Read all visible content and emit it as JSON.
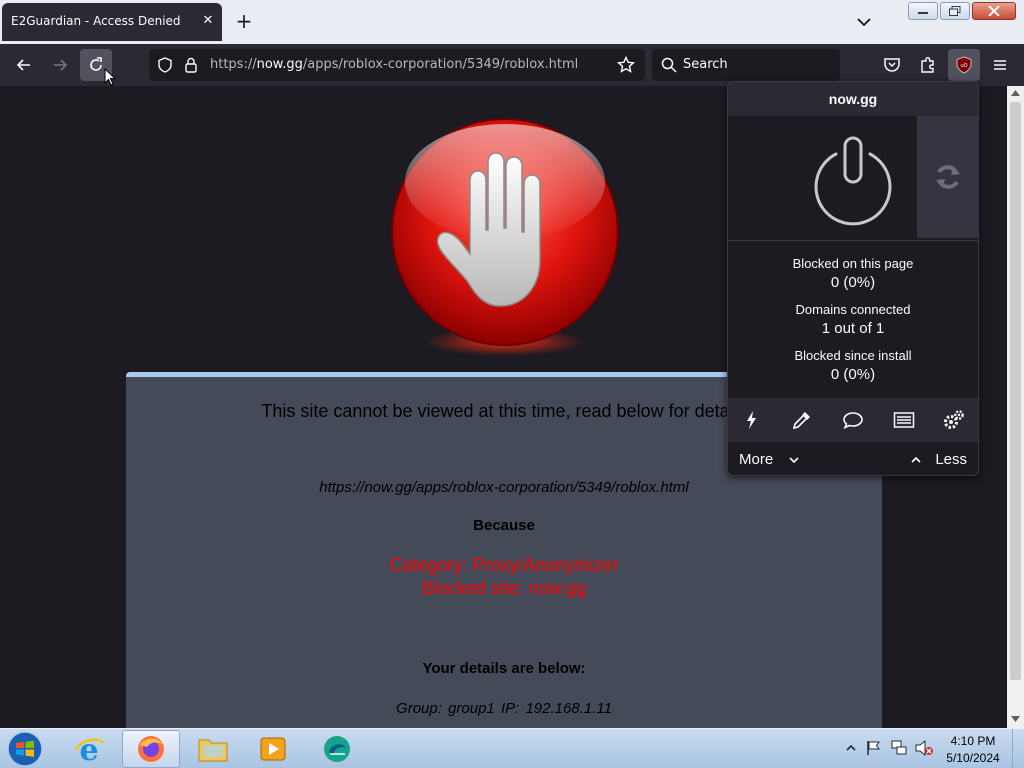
{
  "browser": {
    "tab_title": "E2Guardian - Access Denied",
    "tab_close_glyph": "✕",
    "new_tab_glyph": "+",
    "url_prefix": "https://",
    "url_host": "now.gg",
    "url_path": "/apps/roblox-corporation/5349/roblox.html",
    "search_placeholder": "Search"
  },
  "page": {
    "heading": "This site cannot be viewed at this time, read below for details",
    "blocked_url": "https://now.gg/apps/roblox-corporation/5349/roblox.html",
    "because_label": "Because",
    "category": "Category: Proxy/Anonymizer",
    "blocked_site": "Blocked site: now.gg",
    "details_heading": "Your details are below:",
    "details_line": "Group: group1   IP: 192.168.1.11"
  },
  "popup": {
    "hostname": "now.gg",
    "stats": [
      {
        "label": "Blocked on this page",
        "value": "0 (0%)"
      },
      {
        "label": "Domains connected",
        "value": "1 out of 1"
      },
      {
        "label": "Blocked since install",
        "value": "0 (0%)"
      }
    ],
    "more_label": "More",
    "less_label": "Less"
  },
  "taskbar": {
    "apps": [
      "internet-explorer",
      "firefox",
      "file-explorer",
      "media-player",
      "app"
    ],
    "active_app": "firefox",
    "time": "4:10 PM",
    "date": "5/10/2024"
  },
  "colors": {
    "browser_dark": "#2b2a33",
    "page_bg": "#1c1b22",
    "panel_bg": "#454a58",
    "reason_red": "#ff0000",
    "taskbar": "#b9d1ea"
  }
}
